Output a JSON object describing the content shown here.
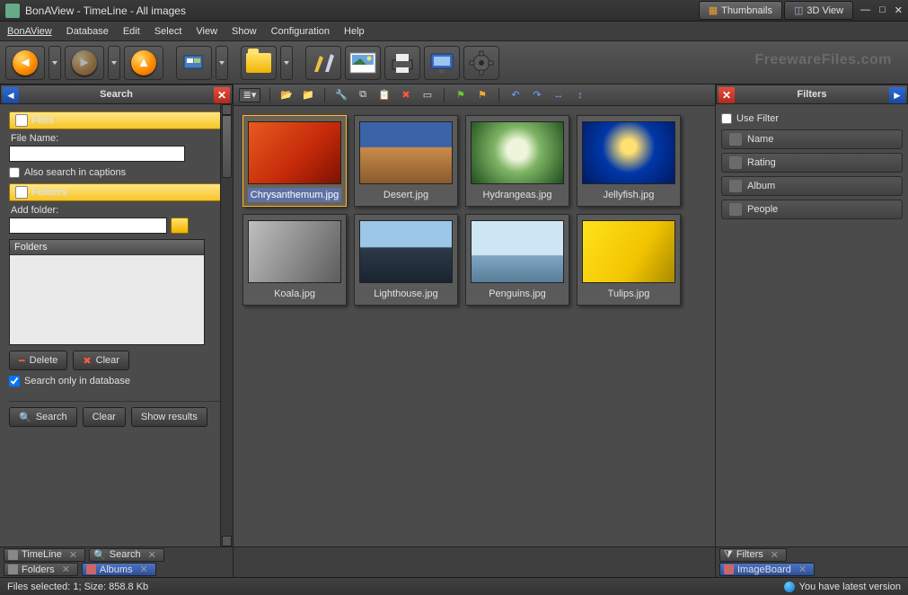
{
  "title": "BonAView - TimeLine - All images",
  "modeTabs": {
    "thumbnails": "Thumbnails",
    "view3d": "3D View"
  },
  "menu": {
    "app": "BonAView",
    "database": "Database",
    "edit": "Edit",
    "select": "Select",
    "view": "View",
    "show": "Show",
    "configuration": "Configuration",
    "help": "Help"
  },
  "watermark": "FreewareFiles.com",
  "search": {
    "title": "Search",
    "filesHeader": "Files",
    "fileNameLabel": "File Name:",
    "fileNameValue": "",
    "alsoCaptions": "Also search in captions",
    "foldersHeader": "Folders",
    "addFolderLabel": "Add folder:",
    "addFolderValue": "",
    "foldersBoxHeader": "Folders",
    "deleteBtn": "Delete",
    "clearBtn": "Clear",
    "searchOnlyDb": "Search only in database",
    "searchBtn": "Search",
    "clearBtn2": "Clear",
    "showResultsBtn": "Show results"
  },
  "filters": {
    "title": "Filters",
    "useFilter": "Use Filter",
    "rows": [
      {
        "label": "Name"
      },
      {
        "label": "Rating"
      },
      {
        "label": "Album"
      },
      {
        "label": "People"
      }
    ]
  },
  "thumbsList": [
    {
      "file": "Chrysanthemum.jpg",
      "bg": "linear-gradient(135deg,#e85a1f,#c22808 60%,#7a1204)",
      "selected": true
    },
    {
      "file": "Desert.jpg",
      "bg": "linear-gradient(#3b63a8 40%,#c98b4b 42%,#8a5a2d)"
    },
    {
      "file": "Hydrangeas.jpg",
      "bg": "radial-gradient(circle at 50% 45%,#eef5dc 18%,#7fb565 40%,#1e4d1e)"
    },
    {
      "file": "Jellyfish.jpg",
      "bg": "radial-gradient(circle at 50% 40%,#ffe070 12%,#0037a8 45%,#001a60)"
    },
    {
      "file": "Koala.jpg",
      "bg": "linear-gradient(120deg,#bfbfbf,#8a8a8a 55%,#5c5c5c)"
    },
    {
      "file": "Lighthouse.jpg",
      "bg": "linear-gradient(#9cc7e8 42%,#2b3a48 44%,#1a2430)"
    },
    {
      "file": "Penguins.jpg",
      "bg": "linear-gradient(#cfe6f5 55%,#7da6c4 57%,#5a7d98)"
    },
    {
      "file": "Tulips.jpg",
      "bg": "linear-gradient(120deg,#ffe21a,#f2c400 60%,#a98a00)"
    }
  ],
  "bottomTabs": {
    "timeline": "TimeLine",
    "search": "Search",
    "folders": "Folders",
    "albums": "Albums",
    "filters": "Filters",
    "imageBoard": "ImageBoard"
  },
  "status": {
    "left": "Files selected: 1; Size: 858.8 Kb",
    "right": "You have latest version"
  }
}
